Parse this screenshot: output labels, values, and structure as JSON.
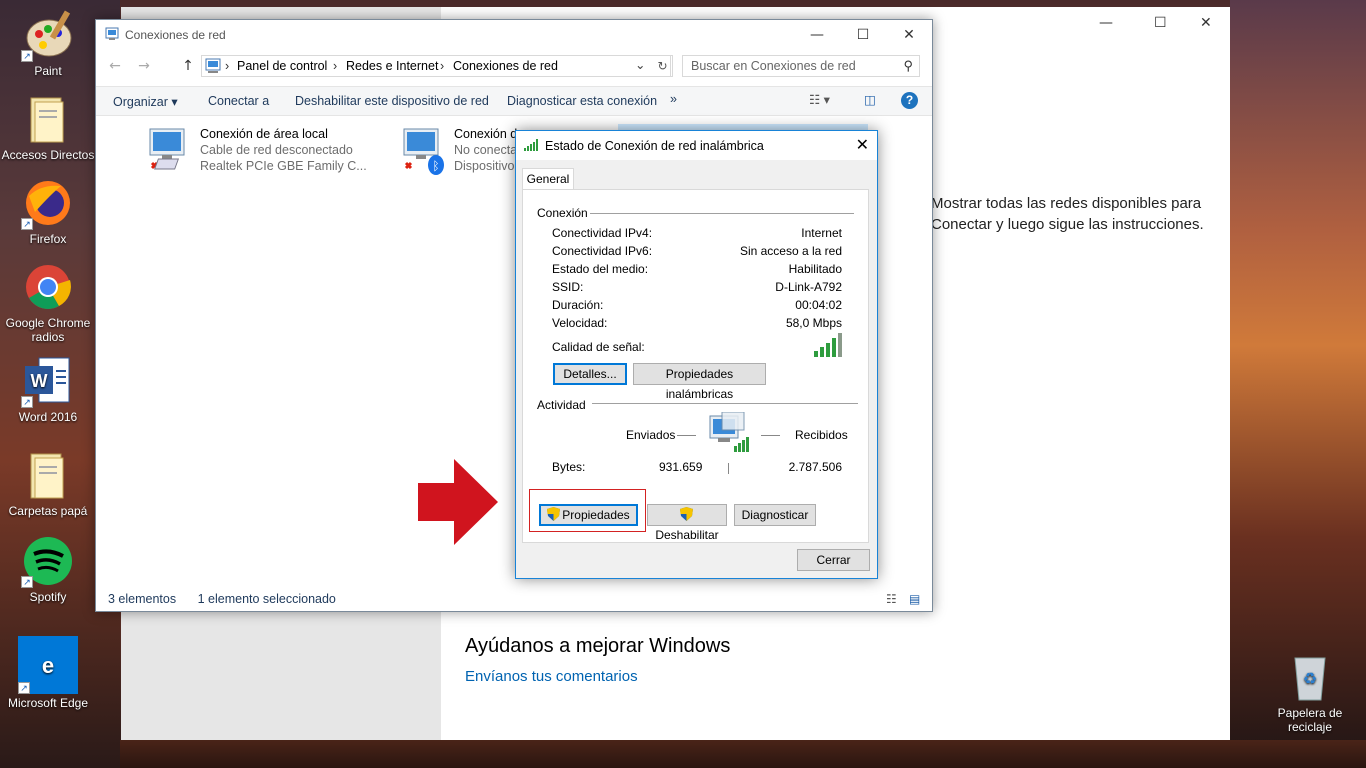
{
  "desktop": {
    "icons": [
      {
        "label": "Paint",
        "icon": "paint-icon"
      },
      {
        "label": "Accesos Directos",
        "icon": "folder-icon"
      },
      {
        "label": "Firefox",
        "icon": "firefox-icon"
      },
      {
        "label": "Google Chrome radios",
        "icon": "chrome-icon"
      },
      {
        "label": "Word 2016",
        "icon": "word-icon"
      },
      {
        "label": "Carpetas papá",
        "icon": "folder-icon"
      },
      {
        "label": "Spotify",
        "icon": "spotify-icon"
      },
      {
        "label": "Microsoft Edge",
        "icon": "edge-icon"
      }
    ],
    "recycle_bin": "Papelera de reciclaje"
  },
  "settings": {
    "text_line1": "Mostrar todas las redes disponibles para",
    "text_line2": "Conectar y luego sigue las instrucciones.",
    "help_title": "Ayúdanos a mejorar Windows",
    "help_link": "Envíanos tus comentarios"
  },
  "explorer": {
    "title": "Conexiones de red",
    "breadcrumb": [
      "Panel de control",
      "Redes e Internet",
      "Conexiones de red"
    ],
    "search_placeholder": "Buscar en Conexiones de red",
    "toolbar": {
      "organize": "Organizar",
      "connect": "Conectar a",
      "disable": "Deshabilitar este dispositivo de red",
      "diagnose": "Diagnosticar esta conexión",
      "more": "»"
    },
    "connections": [
      {
        "name": "Conexión de área local",
        "status": "Cable de red desconectado",
        "device": "Realtek PCIe GBE Family C..."
      },
      {
        "name": "Conexión d",
        "status": "No conecta",
        "device": "Dispositivo"
      }
    ],
    "status": {
      "count": "3 elementos",
      "selected": "1 elemento seleccionado"
    }
  },
  "dialog": {
    "title": "Estado de Conexión de red inalámbrica",
    "tab": "General",
    "connection_section": "Conexión",
    "rows": [
      {
        "label": "Conectividad IPv4:",
        "value": "Internet"
      },
      {
        "label": "Conectividad IPv6:",
        "value": "Sin acceso a la red"
      },
      {
        "label": "Estado del medio:",
        "value": "Habilitado"
      },
      {
        "label": "SSID:",
        "value": "D-Link-A792"
      },
      {
        "label": "Duración:",
        "value": "00:04:02"
      },
      {
        "label": "Velocidad:",
        "value": "58,0 Mbps"
      }
    ],
    "signal_label": "Calidad de señal:",
    "signal_bars": 5,
    "details_button": "Detalles...",
    "wireless_props_button": "Propiedades inalámbricas",
    "activity_section": "Actividad",
    "sent_label": "Enviados",
    "received_label": "Recibidos",
    "bytes_label": "Bytes:",
    "bytes_sent": "931.659",
    "bytes_received": "2.787.506",
    "properties_button": "Propiedades",
    "disable_button": "Deshabilitar",
    "diagnose_button": "Diagnosticar",
    "close_button": "Cerrar"
  },
  "colors": {
    "accent": "#0078d7",
    "highlight_box": "#d32222",
    "arrow": "#d0141e",
    "signal": "#2e9c3e"
  }
}
